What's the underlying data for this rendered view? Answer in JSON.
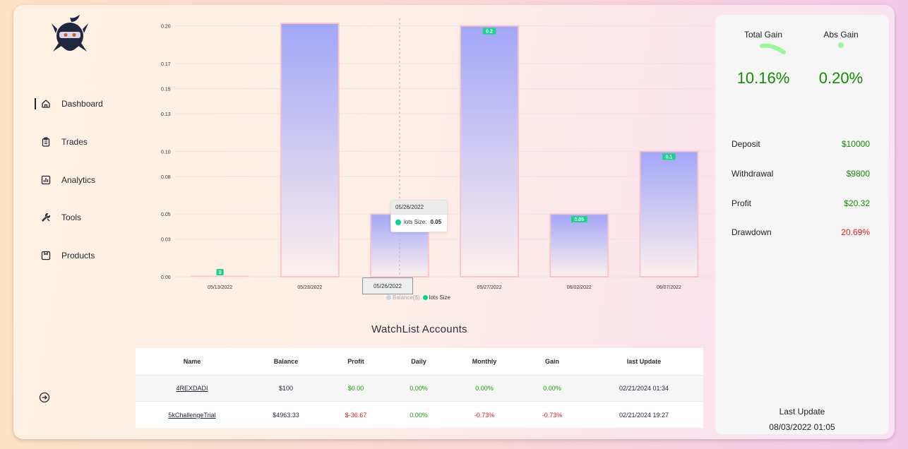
{
  "sidebar": {
    "items": [
      {
        "label": "Dashboard",
        "icon": "home-icon",
        "active": true
      },
      {
        "label": "Trades",
        "icon": "clipboard-icon",
        "active": false
      },
      {
        "label": "Analytics",
        "icon": "bar-chart-icon",
        "active": false
      },
      {
        "label": "Tools",
        "icon": "wrench-icon",
        "active": false
      },
      {
        "label": "Products",
        "icon": "package-icon",
        "active": false
      }
    ],
    "logout_icon": "logout-icon",
    "logo_icon": "ninja-logo-icon"
  },
  "chart_data": {
    "type": "bar",
    "categories": [
      "05/13/2022",
      "05/23/2022",
      "05/26/2022",
      "05/27/2022",
      "06/02/2022",
      "06/07/2022"
    ],
    "series": [
      {
        "name": "Balance($)",
        "hidden": true
      },
      {
        "name": "lots Size",
        "values": [
          0,
          0.21,
          0.05,
          0.2,
          0.05,
          0.1
        ],
        "data_labels": [
          "0",
          "",
          "0.0",
          "0.2",
          "0.05",
          "0.1"
        ]
      }
    ],
    "y_ticks": [
      "0.00",
      "0.03",
      "0.05",
      "0.08",
      "0.10",
      "0.13",
      "0.15",
      "0.17",
      "0.20"
    ],
    "ylim": [
      0,
      0.206
    ],
    "grid": true,
    "legend_position": "bottom",
    "colors": {
      "bar_top": "#a3a6f8",
      "bar_bottom": "#fdf0ee",
      "bar_border": "#f6c6cc",
      "label_bg": "#19d48a"
    },
    "tooltip": {
      "date": "05/26/2022",
      "series": "lots Size:",
      "value": "0.05"
    },
    "hover_category": "05/26/2022"
  },
  "watchlist": {
    "title": "WatchList Accounts",
    "headers": [
      "Name",
      "Balance",
      "Profit",
      "Daily",
      "Monthly",
      "Gain",
      "last Update"
    ],
    "rows": [
      {
        "name": "4REXDADI",
        "balance": "$100",
        "profit": "$0.00",
        "daily": "0.00%",
        "monthly": "0.00%",
        "gain": "0.00%",
        "updated": "02/21/2024 01:34"
      },
      {
        "name": "5kChallengeTrial",
        "balance": "$4963.33",
        "profit": "$-36.67",
        "daily": "0.00%",
        "monthly": "-0.73%",
        "gain": "-0.73%",
        "updated": "02/21/2024 19:27"
      }
    ]
  },
  "panel": {
    "total_gain_label": "Total Gain",
    "total_gain_value": "10.16%",
    "abs_gain_label": "Abs Gain",
    "abs_gain_value": "0.20%",
    "gain_gauge_color": "#9af69a",
    "stats": [
      {
        "label": "Deposit",
        "value": "$10000",
        "color": "positive"
      },
      {
        "label": "Withdrawal",
        "value": "$9800",
        "color": "positive"
      },
      {
        "label": "Profit",
        "value": "$20.32",
        "color": "positive"
      },
      {
        "label": "Drawdown",
        "value": "20.69%",
        "color": "negative"
      }
    ],
    "last_update_label": "Last Update",
    "last_update_value": "08/03/2022 01:05"
  }
}
